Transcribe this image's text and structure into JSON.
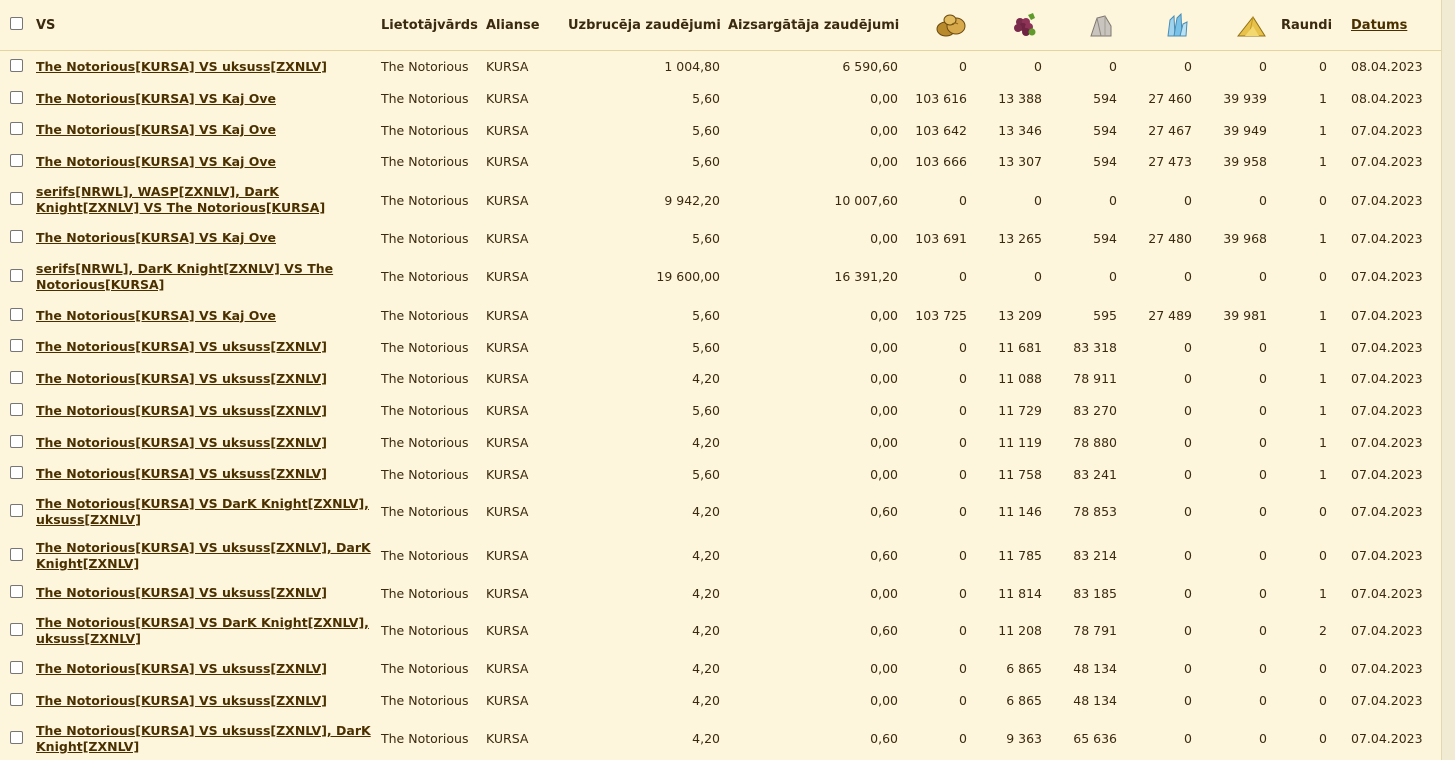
{
  "columns": {
    "vs": "VS",
    "user": "Lietotājvārds",
    "alliance": "Alianse",
    "attacker_loss": "Uzbrucēja zaudējumi",
    "defender_loss": "Aizsargātāja zaudējumi",
    "res1_icon": "bread-icon",
    "res2_icon": "grapes-icon",
    "res3_icon": "marble-icon",
    "res4_icon": "crystal-icon",
    "res5_icon": "sulfur-icon",
    "rounds": "Raundi",
    "date": "Datums"
  },
  "rows": [
    {
      "vs": "The Notorious[KURSA] VS uksuss[ZXNLV]",
      "user": "The Notorious",
      "alliance": "KURSA",
      "attacker_loss": "1 004,80",
      "defender_loss": "6 590,60",
      "r1": "0",
      "r2": "0",
      "r3": "0",
      "r4": "0",
      "r5": "0",
      "rounds": "0",
      "date": "08.04.2023"
    },
    {
      "vs": "The Notorious[KURSA] VS Kaj Ove",
      "user": "The Notorious",
      "alliance": "KURSA",
      "attacker_loss": "5,60",
      "defender_loss": "0,00",
      "r1": "103 616",
      "r2": "13 388",
      "r3": "594",
      "r4": "27 460",
      "r5": "39 939",
      "rounds": "1",
      "date": "08.04.2023"
    },
    {
      "vs": "The Notorious[KURSA] VS Kaj Ove",
      "user": "The Notorious",
      "alliance": "KURSA",
      "attacker_loss": "5,60",
      "defender_loss": "0,00",
      "r1": "103 642",
      "r2": "13 346",
      "r3": "594",
      "r4": "27 467",
      "r5": "39 949",
      "rounds": "1",
      "date": "07.04.2023"
    },
    {
      "vs": "The Notorious[KURSA] VS Kaj Ove",
      "user": "The Notorious",
      "alliance": "KURSA",
      "attacker_loss": "5,60",
      "defender_loss": "0,00",
      "r1": "103 666",
      "r2": "13 307",
      "r3": "594",
      "r4": "27 473",
      "r5": "39 958",
      "rounds": "1",
      "date": "07.04.2023"
    },
    {
      "vs": "serifs[NRWL], WASP[ZXNLV], DarK Knight[ZXNLV] VS The Notorious[KURSA]",
      "user": "The Notorious",
      "alliance": "KURSA",
      "attacker_loss": "9 942,20",
      "defender_loss": "10 007,60",
      "r1": "0",
      "r2": "0",
      "r3": "0",
      "r4": "0",
      "r5": "0",
      "rounds": "0",
      "date": "07.04.2023"
    },
    {
      "vs": "The Notorious[KURSA] VS Kaj Ove",
      "user": "The Notorious",
      "alliance": "KURSA",
      "attacker_loss": "5,60",
      "defender_loss": "0,00",
      "r1": "103 691",
      "r2": "13 265",
      "r3": "594",
      "r4": "27 480",
      "r5": "39 968",
      "rounds": "1",
      "date": "07.04.2023"
    },
    {
      "vs": "serifs[NRWL], DarK Knight[ZXNLV] VS The Notorious[KURSA]",
      "user": "The Notorious",
      "alliance": "KURSA",
      "attacker_loss": "19 600,00",
      "defender_loss": "16 391,20",
      "r1": "0",
      "r2": "0",
      "r3": "0",
      "r4": "0",
      "r5": "0",
      "rounds": "0",
      "date": "07.04.2023"
    },
    {
      "vs": "The Notorious[KURSA] VS Kaj Ove",
      "user": "The Notorious",
      "alliance": "KURSA",
      "attacker_loss": "5,60",
      "defender_loss": "0,00",
      "r1": "103 725",
      "r2": "13 209",
      "r3": "595",
      "r4": "27 489",
      "r5": "39 981",
      "rounds": "1",
      "date": "07.04.2023"
    },
    {
      "vs": "The Notorious[KURSA] VS uksuss[ZXNLV]",
      "user": "The Notorious",
      "alliance": "KURSA",
      "attacker_loss": "5,60",
      "defender_loss": "0,00",
      "r1": "0",
      "r2": "11 681",
      "r3": "83 318",
      "r4": "0",
      "r5": "0",
      "rounds": "1",
      "date": "07.04.2023"
    },
    {
      "vs": "The Notorious[KURSA] VS uksuss[ZXNLV]",
      "user": "The Notorious",
      "alliance": "KURSA",
      "attacker_loss": "4,20",
      "defender_loss": "0,00",
      "r1": "0",
      "r2": "11 088",
      "r3": "78 911",
      "r4": "0",
      "r5": "0",
      "rounds": "1",
      "date": "07.04.2023"
    },
    {
      "vs": "The Notorious[KURSA] VS uksuss[ZXNLV]",
      "user": "The Notorious",
      "alliance": "KURSA",
      "attacker_loss": "5,60",
      "defender_loss": "0,00",
      "r1": "0",
      "r2": "11 729",
      "r3": "83 270",
      "r4": "0",
      "r5": "0",
      "rounds": "1",
      "date": "07.04.2023"
    },
    {
      "vs": "The Notorious[KURSA] VS uksuss[ZXNLV]",
      "user": "The Notorious",
      "alliance": "KURSA",
      "attacker_loss": "4,20",
      "defender_loss": "0,00",
      "r1": "0",
      "r2": "11 119",
      "r3": "78 880",
      "r4": "0",
      "r5": "0",
      "rounds": "1",
      "date": "07.04.2023"
    },
    {
      "vs": "The Notorious[KURSA] VS uksuss[ZXNLV]",
      "user": "The Notorious",
      "alliance": "KURSA",
      "attacker_loss": "5,60",
      "defender_loss": "0,00",
      "r1": "0",
      "r2": "11 758",
      "r3": "83 241",
      "r4": "0",
      "r5": "0",
      "rounds": "1",
      "date": "07.04.2023"
    },
    {
      "vs": "The Notorious[KURSA] VS DarK Knight[ZXNLV], uksuss[ZXNLV]",
      "user": "The Notorious",
      "alliance": "KURSA",
      "attacker_loss": "4,20",
      "defender_loss": "0,60",
      "r1": "0",
      "r2": "11 146",
      "r3": "78 853",
      "r4": "0",
      "r5": "0",
      "rounds": "0",
      "date": "07.04.2023"
    },
    {
      "vs": "The Notorious[KURSA] VS uksuss[ZXNLV], DarK Knight[ZXNLV]",
      "user": "The Notorious",
      "alliance": "KURSA",
      "attacker_loss": "4,20",
      "defender_loss": "0,60",
      "r1": "0",
      "r2": "11 785",
      "r3": "83 214",
      "r4": "0",
      "r5": "0",
      "rounds": "0",
      "date": "07.04.2023"
    },
    {
      "vs": "The Notorious[KURSA] VS uksuss[ZXNLV]",
      "user": "The Notorious",
      "alliance": "KURSA",
      "attacker_loss": "4,20",
      "defender_loss": "0,00",
      "r1": "0",
      "r2": "11 814",
      "r3": "83 185",
      "r4": "0",
      "r5": "0",
      "rounds": "1",
      "date": "07.04.2023"
    },
    {
      "vs": "The Notorious[KURSA] VS DarK Knight[ZXNLV], uksuss[ZXNLV]",
      "user": "The Notorious",
      "alliance": "KURSA",
      "attacker_loss": "4,20",
      "defender_loss": "0,60",
      "r1": "0",
      "r2": "11 208",
      "r3": "78 791",
      "r4": "0",
      "r5": "0",
      "rounds": "2",
      "date": "07.04.2023"
    },
    {
      "vs": "The Notorious[KURSA] VS uksuss[ZXNLV]",
      "user": "The Notorious",
      "alliance": "KURSA",
      "attacker_loss": "4,20",
      "defender_loss": "0,00",
      "r1": "0",
      "r2": "6 865",
      "r3": "48 134",
      "r4": "0",
      "r5": "0",
      "rounds": "0",
      "date": "07.04.2023"
    },
    {
      "vs": "The Notorious[KURSA] VS uksuss[ZXNLV]",
      "user": "The Notorious",
      "alliance": "KURSA",
      "attacker_loss": "4,20",
      "defender_loss": "0,00",
      "r1": "0",
      "r2": "6 865",
      "r3": "48 134",
      "r4": "0",
      "r5": "0",
      "rounds": "0",
      "date": "07.04.2023"
    },
    {
      "vs": "The Notorious[KURSA] VS uksuss[ZXNLV], DarK Knight[ZXNLV]",
      "user": "The Notorious",
      "alliance": "KURSA",
      "attacker_loss": "4,20",
      "defender_loss": "0,60",
      "r1": "0",
      "r2": "9 363",
      "r3": "65 636",
      "r4": "0",
      "r5": "0",
      "rounds": "0",
      "date": "07.04.2023"
    }
  ]
}
